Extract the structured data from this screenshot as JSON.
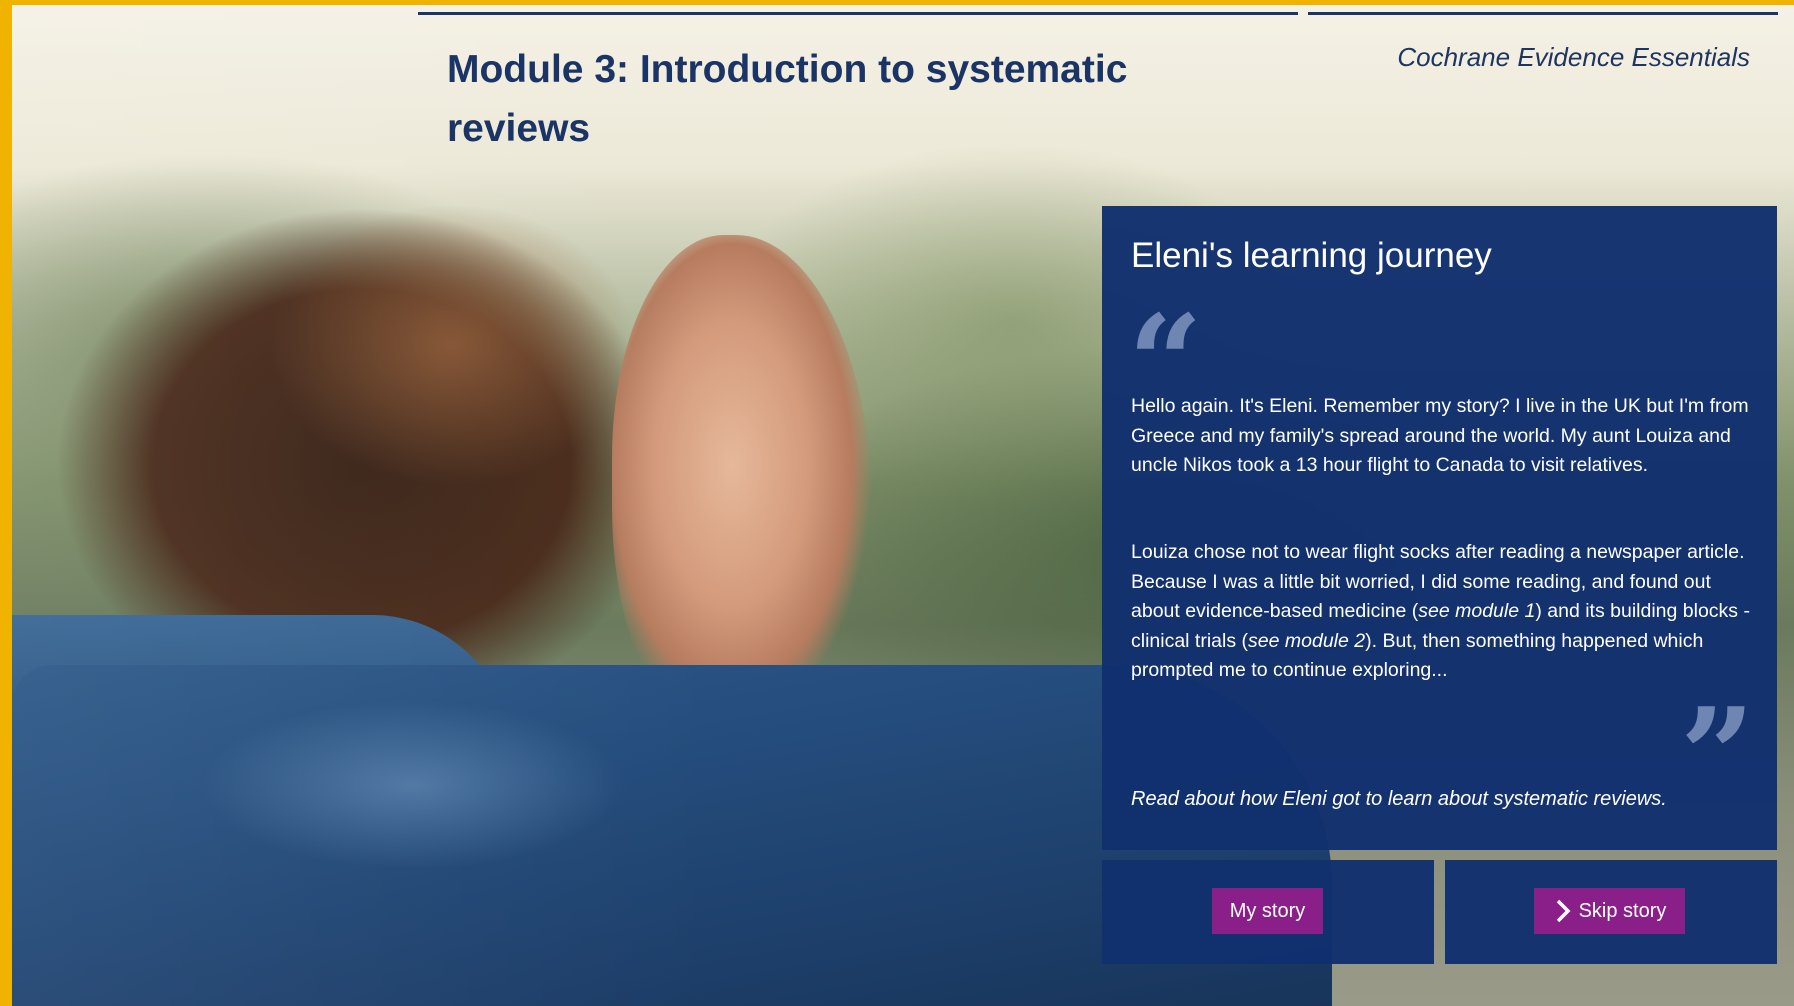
{
  "header": {
    "module_title": "Module 3: Introduction to systematic reviews",
    "course_name": "Cochrane Evidence Essentials"
  },
  "story": {
    "heading": "Eleni's learning journey",
    "quote_open": "“",
    "quote_close": "”",
    "para1": "Hello again. It's Eleni. Remember my story? I live in the UK but I'm from Greece and my family's spread around the world. My aunt Louiza and uncle Nikos took a 13 hour flight to Canada to visit relatives.",
    "para2_part1": "Louiza chose not to wear flight socks after reading a newspaper article. Because I was a little bit worried, I did some reading, and found out about evidence-based medicine (",
    "para2_ref1": "see module 1",
    "para2_part2": ") and its building blocks - clinical trials (",
    "para2_ref2": "see module 2",
    "para2_part3": "). But, then something happened which prompted me to continue exploring...",
    "footer": "Read about how Eleni got to learn about systematic reviews."
  },
  "buttons": {
    "my_story": "My story",
    "skip_story": "Skip story"
  },
  "icons": {
    "skip": "chevron-right-icon"
  },
  "colors": {
    "frame": "#f0b400",
    "panel": "#112f6e",
    "title": "#1b3466",
    "button": "#8b1f8a"
  }
}
